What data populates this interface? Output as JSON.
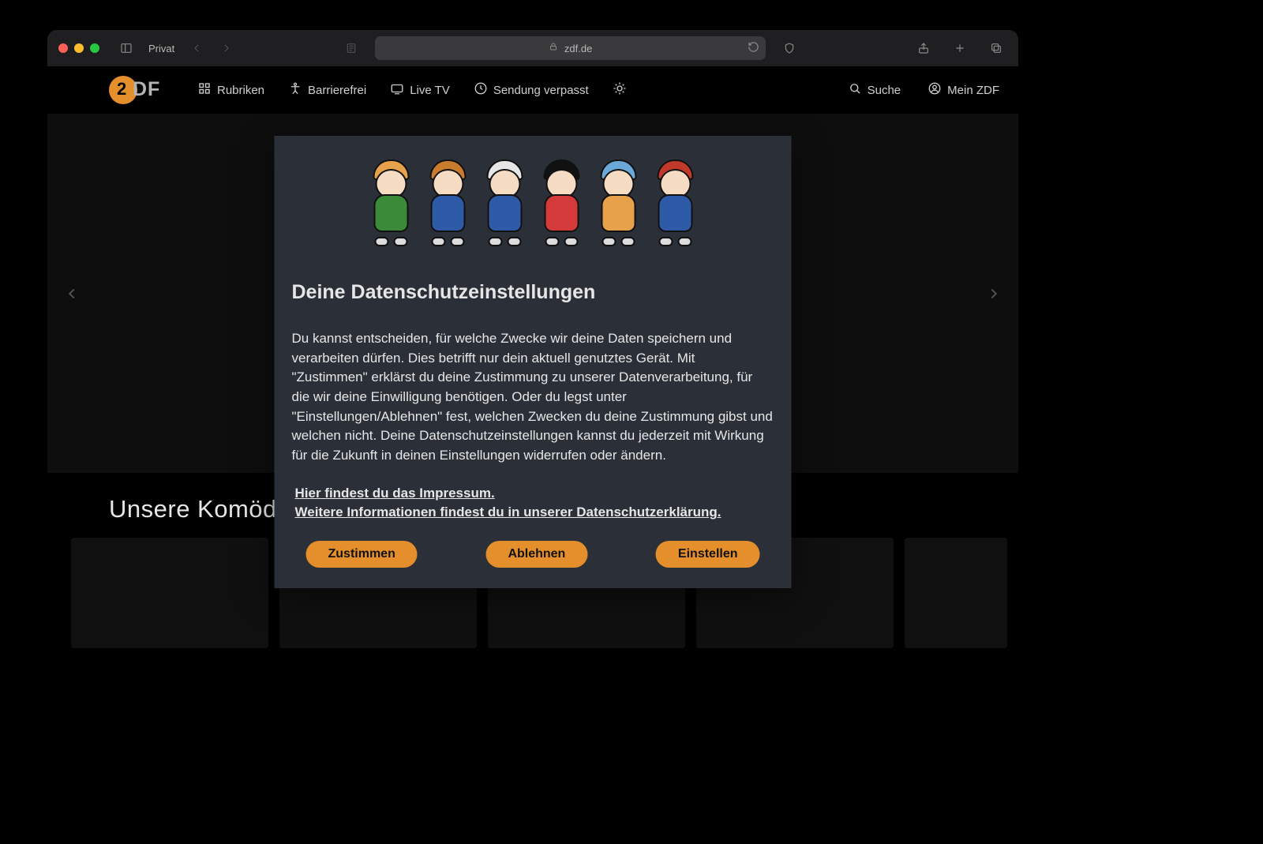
{
  "browser": {
    "private_label": "Privat",
    "domain": "zdf.de"
  },
  "nav": {
    "logo_text_num": "2",
    "logo_text_df": "DF",
    "items": [
      {
        "icon": "grid",
        "label": "Rubriken"
      },
      {
        "icon": "accessibility",
        "label": "Barrierefrei"
      },
      {
        "icon": "tv",
        "label": "Live TV"
      },
      {
        "icon": "clock",
        "label": "Sendung verpasst"
      },
      {
        "icon": "brightness",
        "label": ""
      }
    ],
    "right": [
      {
        "icon": "search",
        "label": "Suche"
      },
      {
        "icon": "account",
        "label": "Mein ZDF"
      }
    ]
  },
  "row": {
    "title": "Unsere Komödien-Highlights"
  },
  "modal": {
    "mascots": [
      {
        "cap": "#e7a14a",
        "body": "#3a8a3a"
      },
      {
        "cap": "#c97b2e",
        "body": "#2f5aa8"
      },
      {
        "cap": "#e6e6e6",
        "body": "#2f5aa8"
      },
      {
        "cap": "#111111",
        "body": "#d43a3a"
      },
      {
        "cap": "#6aa8d8",
        "body": "#e7a14a"
      },
      {
        "cap": "#c0392b",
        "body": "#2f5aa8"
      }
    ],
    "title": "Deine Datenschutzeinstellungen",
    "body": "Du kannst entscheiden, für welche Zwecke wir deine Daten speichern und verarbeiten dürfen. Dies betrifft nur dein aktuell genutztes Gerät. Mit \"Zustimmen\" erklärst du deine Zustimmung zu unserer Datenverarbeitung, für die wir deine Einwilligung benötigen. Oder du legst unter \"Einstellungen/Ablehnen\" fest, welchen Zwecken du deine Zustimmung gibst und welchen nicht. Deine Datenschutzeinstellungen kannst du jederzeit mit Wirkung für die Zukunft in deinen Einstellungen widerrufen oder ändern.",
    "link_impressum": "Hier findest du das Impressum.",
    "link_privacy": "Weitere Informationen findest du in unserer Datenschutzerklärung.",
    "btn_accept": "Zustimmen",
    "btn_decline": "Ablehnen",
    "btn_settings": "Einstellen"
  }
}
